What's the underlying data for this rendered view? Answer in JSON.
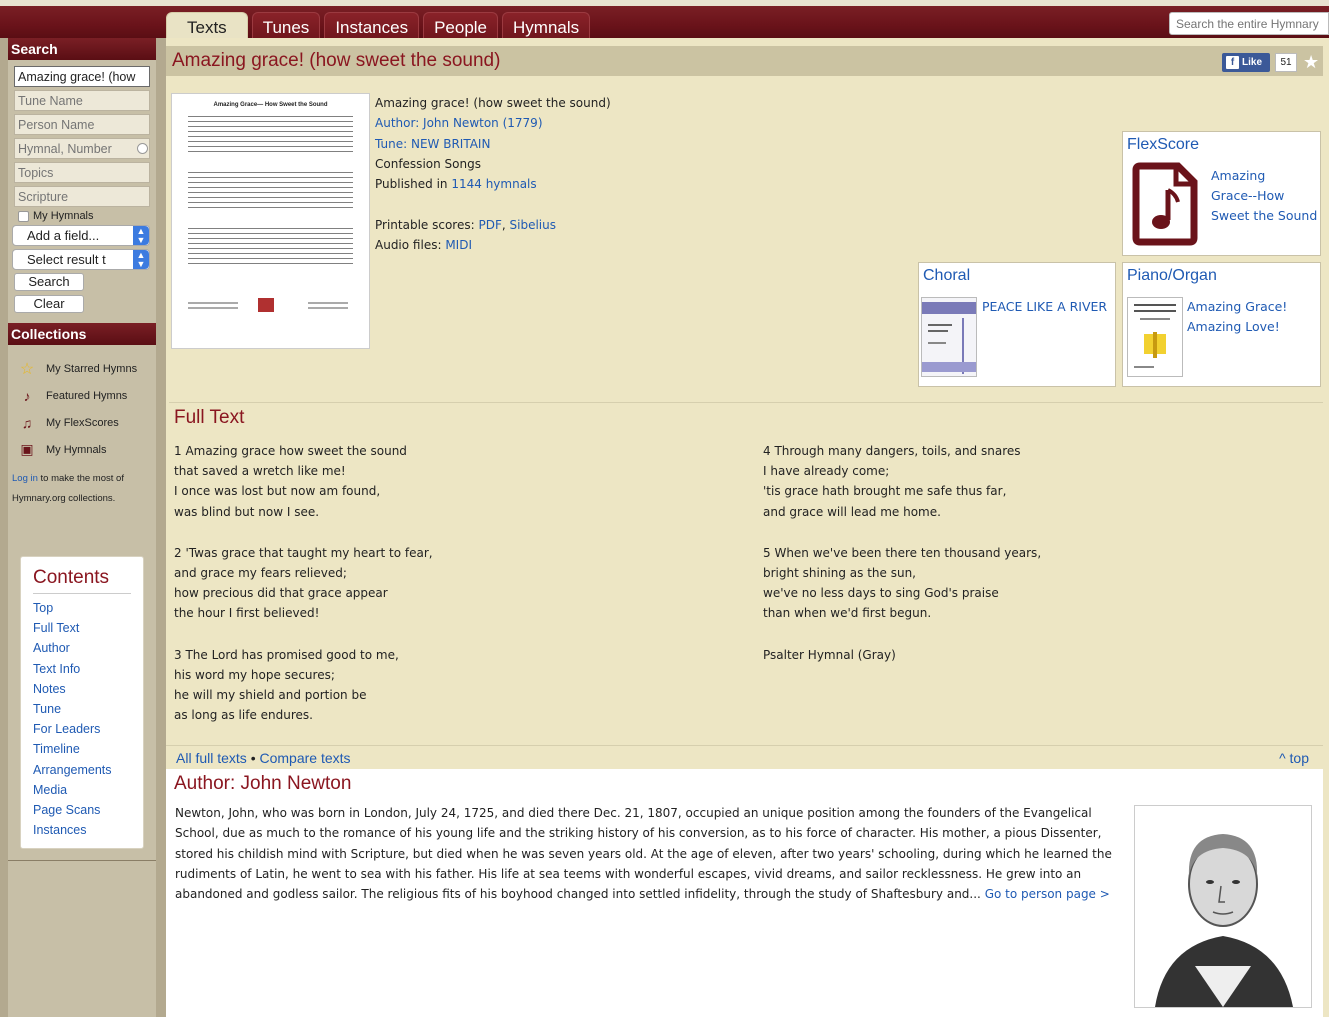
{
  "nav": {
    "tabs": [
      "Texts",
      "Tunes",
      "Instances",
      "People",
      "Hymnals"
    ],
    "site_search_placeholder": "Search the entire Hymnary"
  },
  "sidebar": {
    "search_heading": "Search",
    "query_value": "Amazing grace! (how",
    "fields": [
      "Tune Name",
      "Person Name",
      "Hymnal, Number",
      "Topics",
      "Scripture"
    ],
    "my_hymnals_checkbox": "My Hymnals",
    "add_field_select": "Add a field...",
    "select_result_select": "Select result t",
    "search_button": "Search",
    "clear_button": "Clear",
    "collections_heading": "Collections",
    "collections": [
      {
        "label": "My Starred Hymns",
        "icon": "star-icon"
      },
      {
        "label": "Featured Hymns",
        "icon": "score-icon"
      },
      {
        "label": "My FlexScores",
        "icon": "flexscore-icon"
      },
      {
        "label": "My Hymnals",
        "icon": "hymnal-icon"
      }
    ],
    "login_link": "Log in",
    "login_note_rest": " to make the most of Hymnary.org collections."
  },
  "contents": {
    "heading": "Contents",
    "items": [
      "Top",
      "Full Text",
      "Author",
      "Text Info",
      "Notes",
      "Tune",
      "For Leaders",
      "Timeline",
      "Arrangements",
      "Media",
      "Page Scans",
      "Instances"
    ]
  },
  "page": {
    "title": "Amazing grace! (how sweet the sound)",
    "fb_like": "Like",
    "fb_count": "51",
    "thumb_title": "Amazing Grace— How Sweet the Sound"
  },
  "info": {
    "title_line": "Amazing grace! (how sweet the sound)",
    "author_line": "Author: John Newton (1779)",
    "tune_label": "Tune: ",
    "tune_link": "NEW BRITAIN",
    "topic_line": "Confession Songs",
    "published_prefix": "Published in ",
    "published_link": "1144 hymnals",
    "printable_prefix": "Printable scores: ",
    "pdf_link": "PDF",
    "sibelius_link": "Sibelius",
    "audio_prefix": "Audio files: ",
    "midi_link": "MIDI"
  },
  "flexscore": {
    "heading": "FlexScore",
    "link_lines": [
      "Amazing",
      "Grace--How",
      "Sweet the Sound"
    ]
  },
  "choral": {
    "heading": "Choral",
    "link": "PEACE LIKE A RIVER"
  },
  "piano": {
    "heading": "Piano/Organ",
    "link_lines": [
      "Amazing Grace!",
      "Amazing Love!"
    ]
  },
  "full_text": {
    "heading": "Full Text",
    "left_stanzas": [
      [
        "1 Amazing grace how sweet the sound",
        "that saved a wretch like me!",
        "I once was lost but now am found,",
        "was blind but now I see."
      ],
      [
        "2 'Twas grace that taught my heart to fear,",
        "and grace my fears relieved;",
        "how precious did that grace appear",
        "the hour I first believed!"
      ],
      [
        "3 The Lord has promised good to me,",
        "his word my hope secures;",
        "he will my shield and portion be",
        "as long as life endures."
      ]
    ],
    "right_stanzas": [
      [
        "4 Through many dangers, toils, and snares",
        "I have already come;",
        "'tis grace hath brought me safe thus far,",
        "and grace will lead me home."
      ],
      [
        "5 When we've been there ten thousand years,",
        "bright shining as the sun,",
        "we've no less days to sing God's praise",
        "than when we'd first begun."
      ],
      [
        "Psalter Hymnal (Gray)"
      ]
    ],
    "all_full_texts": "All full texts",
    "compare_texts": "Compare texts",
    "top_link": "^ top"
  },
  "author": {
    "heading": "Author: John Newton",
    "bio": "Newton, John, who was born in London, July 24, 1725, and died there Dec. 21, 1807, occupied an unique position among the founders of the Evangelical School, due as much to the romance of his young life and the striking history of his conversion, as to his force of character. His mother, a pious Dissenter, stored his childish mind with Scripture, but died when he was seven years old. At the age of eleven, after two years' schooling, during which he learned the rudiments of Latin, he went to sea with his father. His life at sea teems with wonderful escapes, vivid dreams, and sailor recklessness. He grew into an abandoned and godless sailor. The religious fits of his boyhood changed into settled infidelity, through the study of Shaftesbury and...",
    "person_link": "Go to person page >"
  },
  "colors": {
    "brand_maroon": "#6a131a",
    "title_red": "#8a1620",
    "link_blue": "#1f5ab3",
    "page_bg": "#ede6c4"
  }
}
